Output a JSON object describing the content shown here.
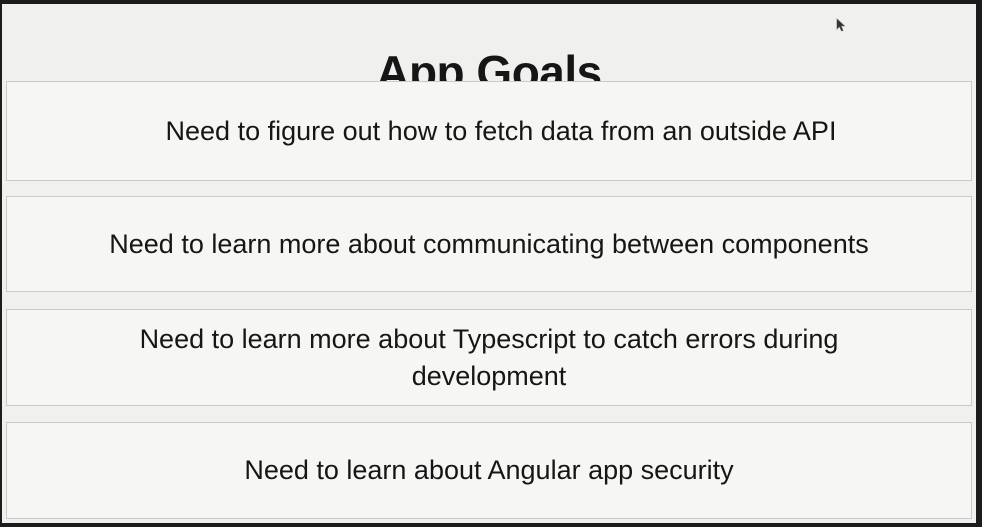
{
  "page": {
    "title": "App Goals"
  },
  "goals": [
    {
      "text": "Need to figure out how to fetch data from an outside API"
    },
    {
      "text": "Need to learn more about communicating between components"
    },
    {
      "text": "Need to learn more about Typescript to catch errors during development"
    },
    {
      "text": "Need to learn about Angular app security"
    }
  ],
  "icons": {
    "cursor": "mouse-pointer-icon"
  },
  "colors": {
    "background": "#f0f0ee",
    "card_border": "#c9c9c9",
    "text": "#161616"
  }
}
